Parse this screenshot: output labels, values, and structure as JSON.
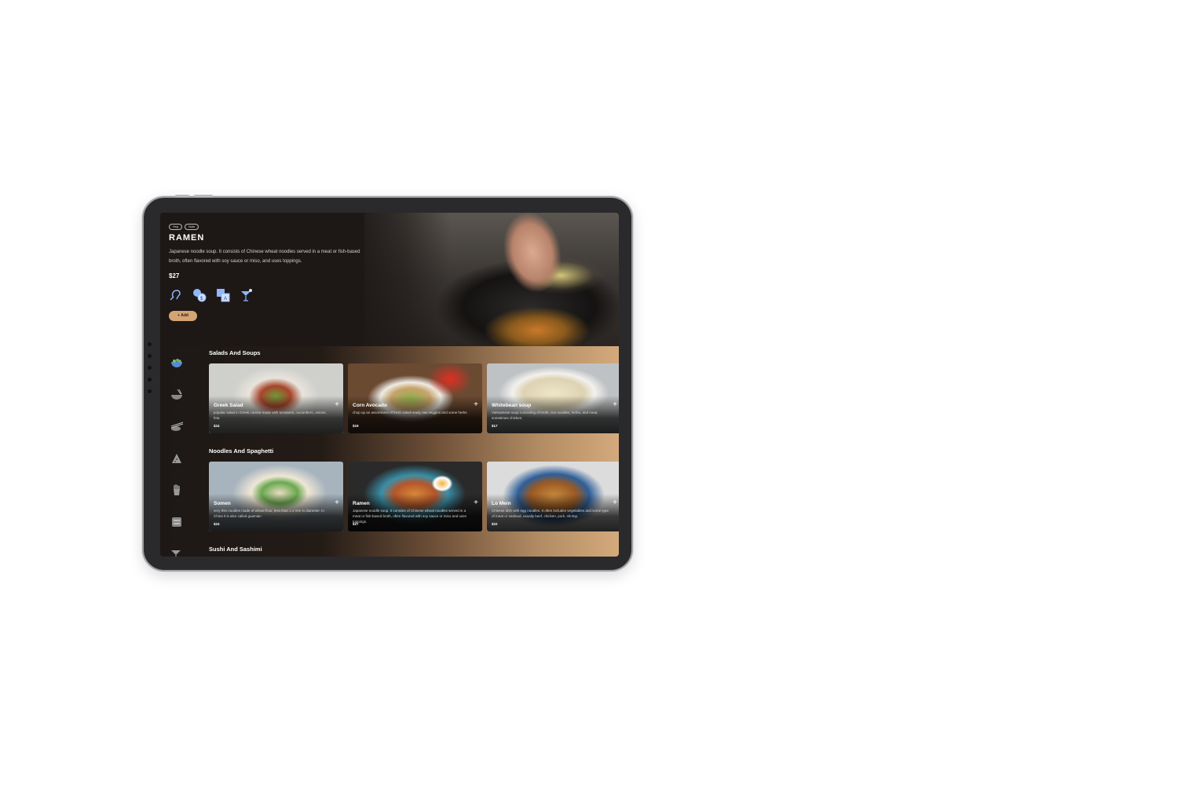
{
  "hero": {
    "tags": [
      "Veg",
      "Nuts"
    ],
    "title": "RAMEN",
    "description": "Japanese noodle soup. It consists of Chinese wheat noodles served in a meat or fish-based broth, often flavored with soy sauce or miso, and uses toppings.",
    "price": "$27",
    "feature_icons": [
      "hearing-assist-icon",
      "currency-exchange-icon",
      "translate-icon",
      "cocktail-icon"
    ],
    "add_label": "+ Add"
  },
  "sidebar": {
    "icons": [
      "salad-bowl-icon",
      "noodle-bowl-icon",
      "sushi-chopsticks-icon",
      "pizza-icon",
      "fries-icon",
      "burger-icon",
      "drink-icon"
    ]
  },
  "sections": [
    {
      "title": "Salads And Soups",
      "items": [
        {
          "name": "Greek Salad",
          "desc": "popular salad in Greek cuisine made with tomatoes, cucumbers, onions, feta",
          "price": "$24"
        },
        {
          "name": "Corn Avocado",
          "desc": "chop up an assortment of fresh salad-ready raw veggies and some herbs",
          "price": "$19"
        },
        {
          "name": "Whitebean soup",
          "desc": "Vietnamese soup consisting of broth, rice noodles, herbs, and meat, sometimes chicken.",
          "price": "$17"
        }
      ]
    },
    {
      "title": "Noodles And Spaghetti",
      "items": [
        {
          "name": "Somen",
          "desc": "very thin noodles made of wheat flour, less than 1.3 mm in diameter. In China it is also called guamian",
          "price": "$24"
        },
        {
          "name": "Ramen",
          "desc": "Japanese noodle soup. It consists of Chinese wheat noodles served in a meat or fish-based broth, often flavored with soy sauce or miso and uses toppings.",
          "price": "$27"
        },
        {
          "name": "Lo Mein",
          "desc": "Chinese dish with egg noodles. It often includes vegetables and some type of meat or seafood, usually beef, chicken, pork, shrimp.",
          "price": "$22"
        }
      ]
    },
    {
      "title": "Sushi And Sashimi",
      "items": []
    }
  ],
  "colors": {
    "accent": "#d4a574",
    "icon_blue": "#8fb6ff",
    "background": "#1d1816"
  }
}
